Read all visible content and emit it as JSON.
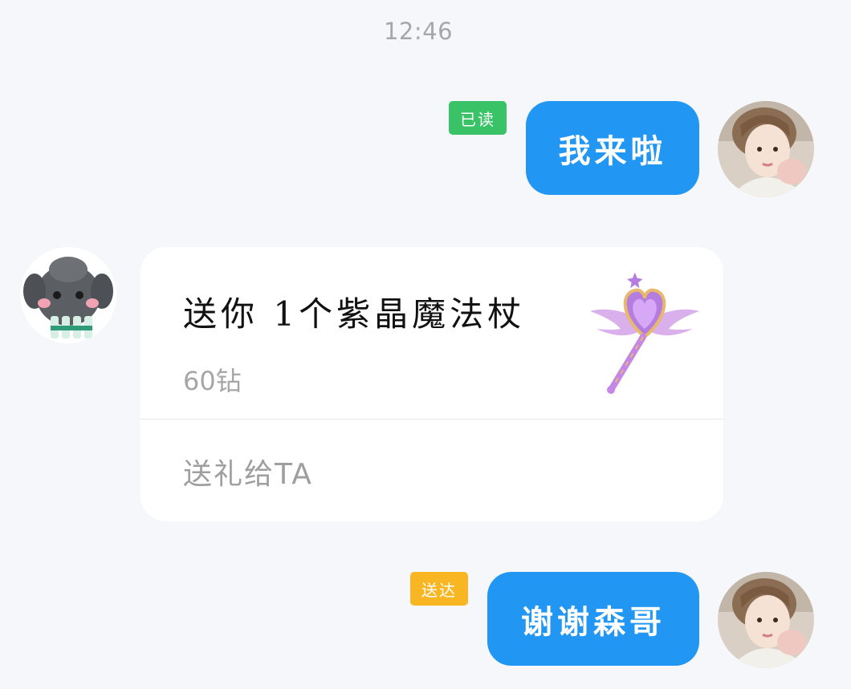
{
  "chat": {
    "timestamp": "12:46",
    "messages": [
      {
        "direction": "outgoing",
        "text": "我来啦",
        "status": "已读",
        "status_color": "#3ac267"
      },
      {
        "direction": "incoming",
        "type": "gift",
        "gift": {
          "title": "送你 1个紫晶魔法杖",
          "price": "60钻",
          "action": "送礼给TA",
          "icon": "purple-heart-magic-wand"
        }
      },
      {
        "direction": "outgoing",
        "text": "谢谢森哥",
        "status": "送达",
        "status_color": "#f8b722"
      }
    ]
  },
  "colors": {
    "background": "#f5f7fa",
    "bubble": "#2296f3",
    "card": "#ffffff"
  }
}
